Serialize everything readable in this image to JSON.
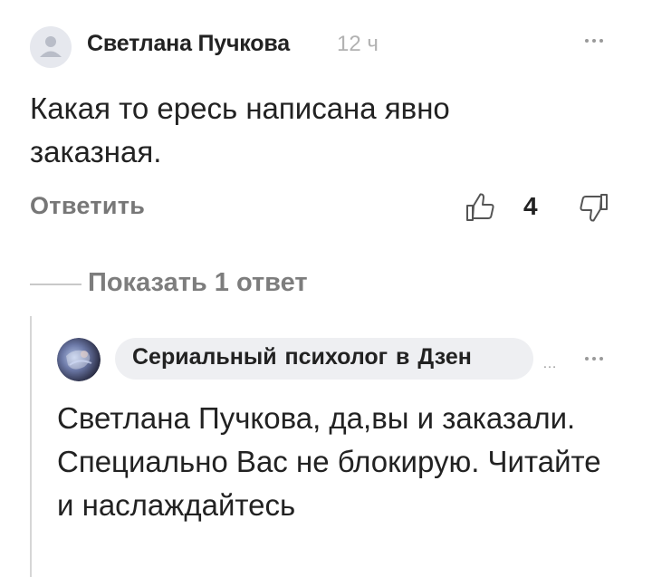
{
  "comment": {
    "author": "Светлана Пучкова",
    "time": "12 ч",
    "text": "Какая то ересь написана явно заказная.",
    "reply_label": "Ответить",
    "likes": "4"
  },
  "show_replies": "Показать 1 ответ",
  "reply": {
    "author": "Сериальный психолог в Дзен",
    "text": "Светлана Пучкова, да,вы и заказали. Специально Вас не блокирую. Читайте и наслаждайтесь"
  },
  "icons": {
    "more": "more-dots-icon",
    "like": "thumb-up-icon",
    "dislike": "thumb-down-icon",
    "avatar": "user-avatar-icon"
  }
}
